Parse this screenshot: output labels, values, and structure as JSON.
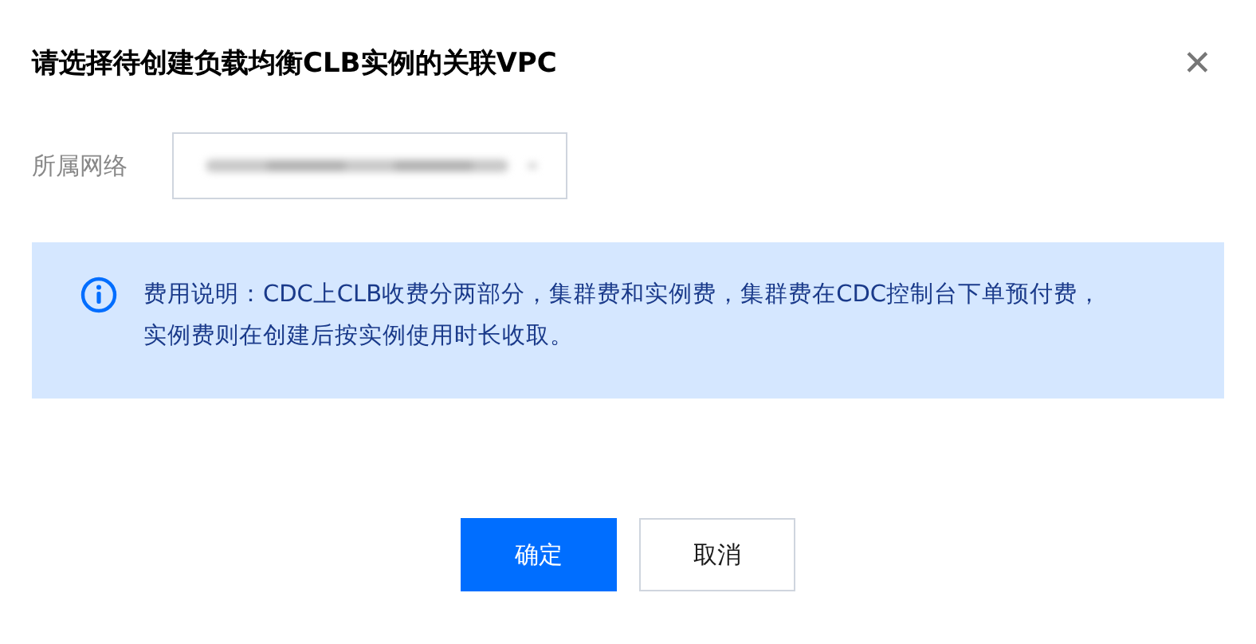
{
  "dialog": {
    "title": "请选择待创建负载均衡CLB实例的关联VPC",
    "close_icon": "✕"
  },
  "field": {
    "label": "所属网络"
  },
  "notice": {
    "text": "费用说明：CDC上CLB收费分两部分，集群费和实例费，集群费在CDC控制台下单预付费，实例费则在创建后按实例使用时长收取。"
  },
  "buttons": [
    {
      "label": "确定",
      "kind": "primary"
    },
    {
      "label": "取消",
      "kind": "secondary"
    }
  ]
}
